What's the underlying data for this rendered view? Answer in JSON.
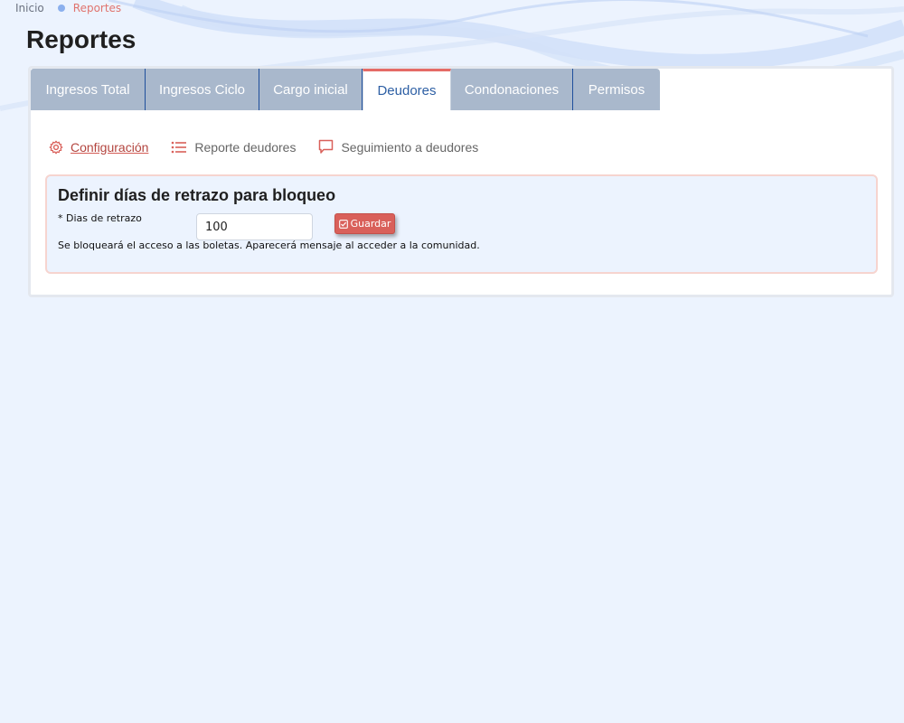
{
  "breadcrumb": {
    "home": "Inicio",
    "current": "Reportes"
  },
  "page": {
    "title": "Reportes"
  },
  "tabs": [
    {
      "label": "Ingresos Total",
      "active": false
    },
    {
      "label": "Ingresos Ciclo",
      "active": false
    },
    {
      "label": "Cargo inicial",
      "active": false
    },
    {
      "label": "Deudores",
      "active": true
    },
    {
      "label": "Condonaciones",
      "active": false
    },
    {
      "label": "Permisos",
      "active": false
    }
  ],
  "subnav": [
    {
      "label": "Configuración",
      "icon": "gear-icon",
      "active": true
    },
    {
      "label": "Reporte deudores",
      "icon": "list-icon",
      "active": false
    },
    {
      "label": "Seguimiento a deudores",
      "icon": "comment-icon",
      "active": false
    }
  ],
  "config": {
    "title": "Definir días de retrazo para bloqueo",
    "field_label": "* Dias de retrazo",
    "field_value": "100",
    "save_label": "Guardar",
    "help_text": "Se bloqueará el acceso a las boletas. Aparecerá mensaje al acceder a la comunidad."
  },
  "colors": {
    "background": "#ecf3fe",
    "tab_inactive": "#a9b8cc",
    "accent_red": "#d9605a",
    "active_tab_text": "#2d5fa4"
  }
}
